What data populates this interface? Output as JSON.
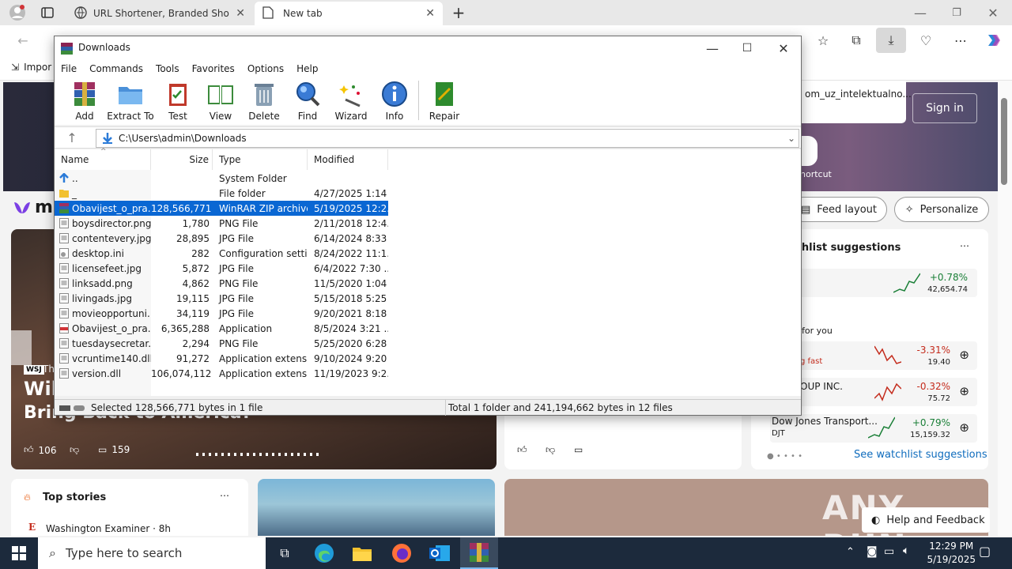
{
  "browser": {
    "tabs": [
      {
        "title": "URL Shortener, Branded Short Lin"
      },
      {
        "title": "New tab"
      }
    ],
    "favorites_bar_item": "Impor",
    "window_controls": [
      "minimize",
      "restore",
      "close"
    ]
  },
  "msn": {
    "logo": "ms",
    "sign_in": "Sign in",
    "suggestion_text": "om_uz_intelektualno...",
    "shortcut_label": "hortcut",
    "feed_layout": "Feed layout",
    "personalize": "Personalize",
    "watchlist_title": "tchlist suggestions",
    "for_you": "for you",
    "falling_fast": "g fast",
    "stocks": [
      {
        "name": "",
        "sub": "",
        "change": "+0.78%",
        "price": "42,654.74",
        "color": "#1a7f37"
      },
      {
        "name": "",
        "sub": "",
        "change": "-3.31%",
        "price": "19.40",
        "color": "#c42b1c"
      },
      {
        "name": "OUP INC.",
        "sub": "",
        "change": "-0.32%",
        "price": "75.72",
        "color": "#c42b1c"
      },
      {
        "name": "Dow Jones Transport...",
        "sub": "DJT",
        "change": "+0.79%",
        "price": "15,159.32",
        "color": "#1a7f37"
      }
    ],
    "see_watchlist": "See watchlist suggestions",
    "hero_title_1": "Wil",
    "hero_title_2": "Bring Back to America?",
    "hero_source": "Th",
    "likes": "106",
    "comments": "159",
    "top_stories": "Top stories",
    "story_source": "Washington Examiner · 8h",
    "help_feedback": "Help and Feedback"
  },
  "rar": {
    "title": "Downloads",
    "menu": [
      "File",
      "Commands",
      "Tools",
      "Favorites",
      "Options",
      "Help"
    ],
    "tools": [
      "Add",
      "Extract To",
      "Test",
      "View",
      "Delete",
      "Find",
      "Wizard",
      "Info",
      "Repair"
    ],
    "path": "C:\\Users\\admin\\Downloads",
    "columns": [
      "Name",
      "Size",
      "Type",
      "Modified"
    ],
    "files": [
      {
        "name": "..",
        "size": "",
        "type": "System Folder",
        "modified": "",
        "icon": "up"
      },
      {
        "name": "_",
        "size": "",
        "type": "File folder",
        "modified": "4/27/2025 1:14 ...",
        "icon": "folder"
      },
      {
        "name": "Obavijest_o_pra...",
        "size": "128,566,771",
        "type": "WinRAR ZIP archive",
        "modified": "5/19/2025 12:2...",
        "icon": "zip",
        "selected": true
      },
      {
        "name": "boysdirector.png",
        "size": "1,780",
        "type": "PNG File",
        "modified": "2/11/2018 12:4...",
        "icon": "img"
      },
      {
        "name": "contentevery.jpg",
        "size": "28,895",
        "type": "JPG File",
        "modified": "6/14/2024 8:33 ...",
        "icon": "img"
      },
      {
        "name": "desktop.ini",
        "size": "282",
        "type": "Configuration setti...",
        "modified": "8/24/2022 11:1...",
        "icon": "ini"
      },
      {
        "name": "licensefeet.jpg",
        "size": "5,872",
        "type": "JPG File",
        "modified": "6/4/2022 7:30 ...",
        "icon": "img"
      },
      {
        "name": "linksadd.png",
        "size": "4,862",
        "type": "PNG File",
        "modified": "11/5/2020 1:04 ...",
        "icon": "img"
      },
      {
        "name": "livingads.jpg",
        "size": "19,115",
        "type": "JPG File",
        "modified": "5/15/2018 5:25 ...",
        "icon": "img"
      },
      {
        "name": "movieopportuni...",
        "size": "34,119",
        "type": "JPG File",
        "modified": "9/20/2021 8:18 ...",
        "icon": "img"
      },
      {
        "name": "Obavijest_o_pra...",
        "size": "6,365,288",
        "type": "Application",
        "modified": "8/5/2024 3:21 ...",
        "icon": "pdf"
      },
      {
        "name": "tuesdaysecretar...",
        "size": "2,294",
        "type": "PNG File",
        "modified": "5/25/2020 6:28 ...",
        "icon": "img"
      },
      {
        "name": "vcruntime140.dll",
        "size": "91,272",
        "type": "Application extens...",
        "modified": "9/10/2024 9:20 ...",
        "icon": "img"
      },
      {
        "name": "version.dll",
        "size": "106,074,112",
        "type": "Application extens...",
        "modified": "11/19/2023 9:2...",
        "icon": "img"
      }
    ],
    "status_left": "Selected 128,566,771 bytes in 1 file",
    "status_right": "Total 1 folder and 241,194,662 bytes in 12 files"
  },
  "taskbar": {
    "search_placeholder": "Type here to search",
    "time": "12:29 PM",
    "date": "5/19/2025"
  },
  "watermark": "ANY RUN"
}
